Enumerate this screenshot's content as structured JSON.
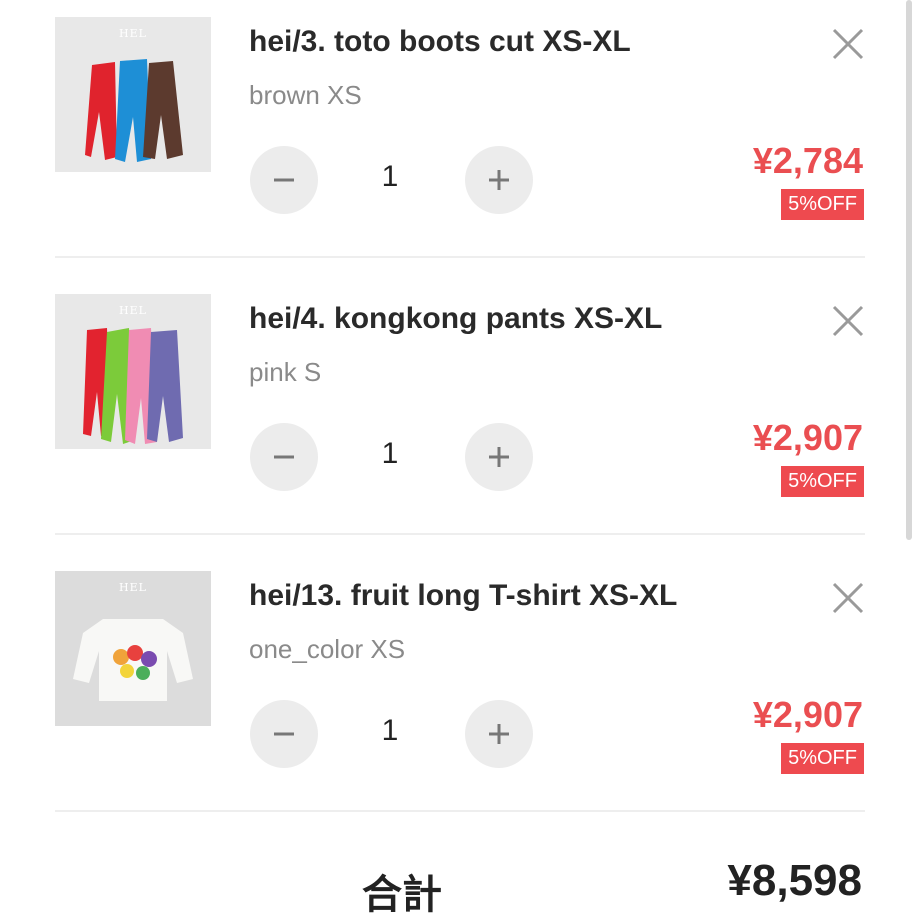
{
  "cart": {
    "items": [
      {
        "title": "hei/3. toto boots cut XS-XL",
        "variant": "brown XS",
        "quantity": "1",
        "price": "¥2,784",
        "discount": "5%OFF",
        "thumb_brand": "HEL"
      },
      {
        "title": "hei/4. kongkong pants XS-XL",
        "variant": "pink S",
        "quantity": "1",
        "price": "¥2,907",
        "discount": "5%OFF",
        "thumb_brand": "HEL"
      },
      {
        "title": "hei/13. fruit long T-shirt XS-XL",
        "variant": "one_color XS",
        "quantity": "1",
        "price": "¥2,907",
        "discount": "5%OFF",
        "thumb_brand": "HEL"
      }
    ],
    "total_label": "合計",
    "total_value": "¥8,598"
  },
  "icons": {
    "remove": "close-icon",
    "decrease": "minus-icon",
    "increase": "plus-icon"
  },
  "colors": {
    "price": "#ea4e51",
    "badge": "#ee4a4f",
    "button_bg": "#ececec",
    "divider": "#eeeeee"
  }
}
